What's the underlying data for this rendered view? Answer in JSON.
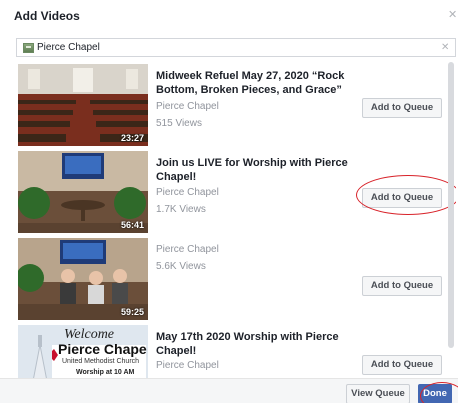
{
  "dialog": {
    "title": "Add Videos",
    "close_icon": "close-icon"
  },
  "search": {
    "value": "Pierce Chapel",
    "page_icon": "page-icon",
    "clear_icon": "clear-icon"
  },
  "videos": [
    {
      "title": "Midweek Refuel May 27, 2020 “Rock Bottom, Broken Pieces, and Grace”",
      "page": "Pierce Chapel",
      "views": "515 Views",
      "duration": "23:27",
      "button": "Add to Queue"
    },
    {
      "title": "Join us LIVE for Worship with Pierce Chapel!",
      "page": "Pierce Chapel",
      "views": "1.7K Views",
      "duration": "56:41",
      "button": "Add to Queue"
    },
    {
      "title": "",
      "page": "Pierce Chapel",
      "views": "5.6K Views",
      "duration": "59:25",
      "button": "Add to Queue"
    },
    {
      "title": "May 17th 2020 Worship with Pierce Chapel!",
      "page": "Pierce Chapel",
      "views": "",
      "duration": "",
      "button": "Add to Queue",
      "thumb_text": {
        "welcome": "Welcome",
        "church": "Pierce Chape",
        "subtitle": "United Methodist Church",
        "time": "Worship at 10 AM"
      }
    }
  ],
  "footer": {
    "view_queue": "View Queue",
    "done": "Done"
  },
  "colors": {
    "primary": "#4267b2",
    "annotation": "#d8232a",
    "muted_text": "#90949c"
  }
}
